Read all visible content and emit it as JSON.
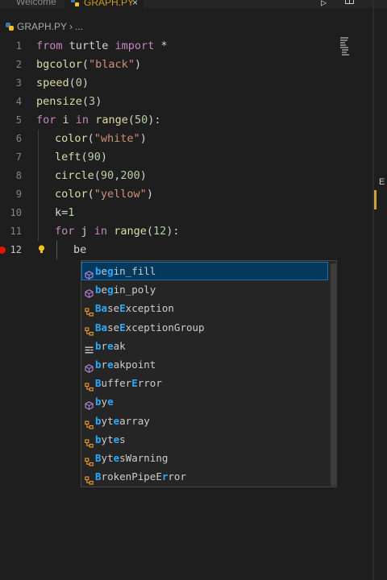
{
  "tabs": [
    {
      "label": "Welcome"
    },
    {
      "label": "GRAPH.PY"
    }
  ],
  "breadcrumb": {
    "file": "GRAPH.PY",
    "separator": "›",
    "ellipsis": "..."
  },
  "editor": {
    "active_line": 12,
    "lines": [
      {
        "n": "1",
        "segs": [
          [
            "kw",
            "from"
          ],
          [
            "t",
            " turtle "
          ],
          [
            "kw",
            "import"
          ],
          [
            "t",
            " *"
          ]
        ]
      },
      {
        "n": "2",
        "segs": [
          [
            "fn",
            "bgcolor"
          ],
          [
            "t",
            "("
          ],
          [
            "str",
            "\"black\""
          ],
          [
            "t",
            ")"
          ]
        ]
      },
      {
        "n": "3",
        "segs": [
          [
            "fn",
            "speed"
          ],
          [
            "t",
            "("
          ],
          [
            "num",
            "0"
          ],
          [
            "t",
            ")"
          ]
        ]
      },
      {
        "n": "4",
        "segs": [
          [
            "fn",
            "pensize"
          ],
          [
            "t",
            "("
          ],
          [
            "num",
            "3"
          ],
          [
            "t",
            ")"
          ]
        ]
      },
      {
        "n": "5",
        "segs": [
          [
            "kw",
            "for"
          ],
          [
            "t",
            " i "
          ],
          [
            "kw",
            "in"
          ],
          [
            "t",
            " "
          ],
          [
            "fn",
            "range"
          ],
          [
            "t",
            "("
          ],
          [
            "num",
            "50"
          ],
          [
            "t",
            "):"
          ]
        ]
      },
      {
        "n": "6",
        "indent": 1,
        "segs": [
          [
            "fn",
            "color"
          ],
          [
            "t",
            "("
          ],
          [
            "str",
            "\"white\""
          ],
          [
            "t",
            ")"
          ]
        ]
      },
      {
        "n": "7",
        "indent": 1,
        "segs": [
          [
            "fn",
            "left"
          ],
          [
            "t",
            "("
          ],
          [
            "num",
            "90"
          ],
          [
            "t",
            ")"
          ]
        ]
      },
      {
        "n": "8",
        "indent": 1,
        "segs": [
          [
            "fn",
            "circle"
          ],
          [
            "t",
            "("
          ],
          [
            "num",
            "90"
          ],
          [
            "t",
            ","
          ],
          [
            "num",
            "200"
          ],
          [
            "t",
            ")"
          ]
        ]
      },
      {
        "n": "9",
        "indent": 1,
        "segs": [
          [
            "fn",
            "color"
          ],
          [
            "t",
            "("
          ],
          [
            "str",
            "\"yellow\""
          ],
          [
            "t",
            ")"
          ]
        ]
      },
      {
        "n": "10",
        "indent": 1,
        "segs": [
          [
            "t",
            "k="
          ],
          [
            "num",
            "1"
          ]
        ]
      },
      {
        "n": "11",
        "indent": 1,
        "segs": [
          [
            "kw",
            "for"
          ],
          [
            "t",
            " j "
          ],
          [
            "kw",
            "in"
          ],
          [
            "t",
            " "
          ],
          [
            "fn",
            "range"
          ],
          [
            "t",
            "("
          ],
          [
            "num",
            "12"
          ],
          [
            "t",
            "):"
          ]
        ]
      },
      {
        "n": "12",
        "indent": 2,
        "segs": [
          [
            "t",
            "be"
          ]
        ],
        "breakpoint": true,
        "lightbulb": true
      }
    ]
  },
  "suggestions": [
    {
      "label": "begin_fill",
      "match": [
        0,
        2
      ],
      "kind": "method",
      "selected": true
    },
    {
      "label": "begin_poly",
      "match": [
        0,
        2
      ],
      "kind": "method"
    },
    {
      "label": "BaseException",
      "match": [
        0,
        1,
        4
      ],
      "kind": "class"
    },
    {
      "label": "BaseExceptionGroup",
      "match": [
        0,
        1,
        4
      ],
      "kind": "class"
    },
    {
      "label": "break",
      "match": [
        0,
        2
      ],
      "kind": "keyword"
    },
    {
      "label": "breakpoint",
      "match": [
        0,
        2
      ],
      "kind": "method"
    },
    {
      "label": "BufferError",
      "match": [
        0,
        6
      ],
      "kind": "class"
    },
    {
      "label": "bye",
      "match": [
        0,
        2
      ],
      "kind": "method"
    },
    {
      "label": "bytearray",
      "match": [
        0,
        3
      ],
      "kind": "class"
    },
    {
      "label": "bytes",
      "match": [
        0,
        3
      ],
      "kind": "class"
    },
    {
      "label": "BytesWarning",
      "match": [
        0,
        3
      ],
      "kind": "class"
    },
    {
      "label": "BrokenPipeError",
      "match": [
        0,
        11
      ],
      "kind": "class"
    }
  ],
  "right_edge_letter": "E",
  "colors": {
    "keyword": "#c586c0",
    "function": "#dcdcaa",
    "string": "#ce9178",
    "number": "#b5cea8",
    "match_highlight": "#2aaaff",
    "selection": "#04395e",
    "breakpoint": "#e51400",
    "tab_accent": "#d19a1a"
  }
}
